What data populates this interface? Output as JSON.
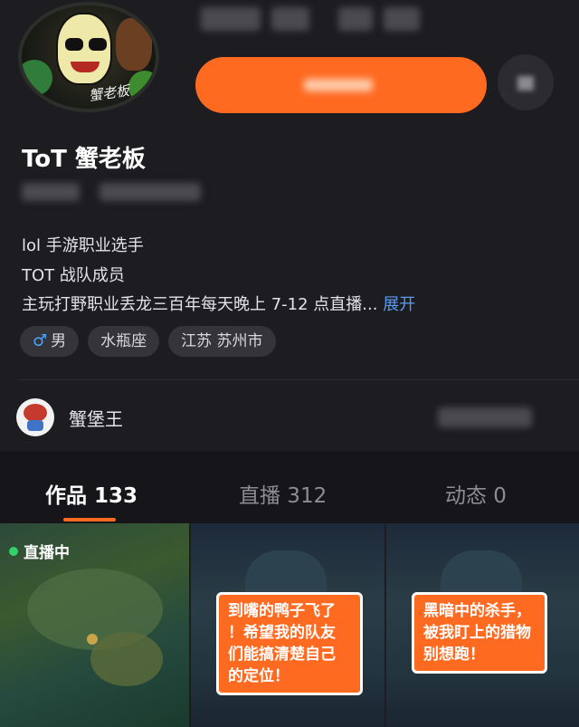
{
  "profile": {
    "name": "ToT 蟹老板",
    "avatar_signature": "蟹老板",
    "bio_lines": [
      "lol 手游职业选手",
      "TOT 战队成员",
      "主玩打野职业丢龙三百年每天晚上 7-12 点直播..."
    ],
    "expand_label": "展开",
    "tags": [
      "男",
      "水瓶座",
      "江苏 苏州市"
    ]
  },
  "friend": {
    "name": "蟹堡王"
  },
  "tabs": [
    {
      "label": "作品 133"
    },
    {
      "label": "直播 312"
    },
    {
      "label": "动态 0"
    }
  ],
  "grid": {
    "live_label": "直播中",
    "video2_caption": [
      "到嘴的鸭子飞了",
      "！希望我的队友",
      "们能搞清楚自己",
      "的定位！"
    ],
    "video3_caption": [
      "黑暗中的杀手，",
      "被我盯上的猎物",
      "别想跑！"
    ]
  },
  "colors": {
    "accent": "#ff6a21",
    "background": "#1c1c21",
    "link": "#5a9cf0",
    "live": "#33d16a"
  }
}
